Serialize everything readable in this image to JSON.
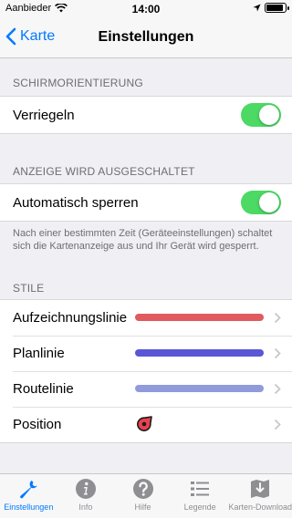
{
  "status_bar": {
    "carrier": "Aanbieder",
    "time": "14:00",
    "battery_level": 0.9
  },
  "nav": {
    "back_label": "Karte",
    "title": "Einstellungen"
  },
  "sections": {
    "orientation": {
      "header": "SCHIRMORIENTIERUNG",
      "row_label": "Verriegeln",
      "toggle_on": true
    },
    "display_off": {
      "header": "ANZEIGE WIRD AUSGESCHALTET",
      "row_label": "Automatisch sperren",
      "toggle_on": true,
      "footer": "Nach einer bestimmten Zeit (Geräteeinstellungen) schaltet sich die Kartenanzeige aus und Ihr Gerät wird gesperrt."
    },
    "styles": {
      "header": "STILE",
      "items": [
        {
          "label": "Aufzeichnungslinie",
          "color": "#e05a5e"
        },
        {
          "label": "Planlinie",
          "color": "#5957d6"
        },
        {
          "label": "Routelinie",
          "color": "#8f9bdb"
        },
        {
          "label": "Position",
          "icon": "position-marker-icon",
          "color": "#e8414f"
        }
      ]
    }
  },
  "tabs": [
    {
      "label": "Einstellungen",
      "icon": "wrench-icon",
      "active": true
    },
    {
      "label": "Info",
      "icon": "info-icon",
      "active": false
    },
    {
      "label": "Hilfe",
      "icon": "help-icon",
      "active": false
    },
    {
      "label": "Legende",
      "icon": "list-icon",
      "active": false
    },
    {
      "label": "Karten-Download",
      "icon": "map-download-icon",
      "active": false
    }
  ],
  "colors": {
    "accent": "#007aff",
    "toggle_on": "#4cd964",
    "tab_inactive": "#8e8e93"
  }
}
